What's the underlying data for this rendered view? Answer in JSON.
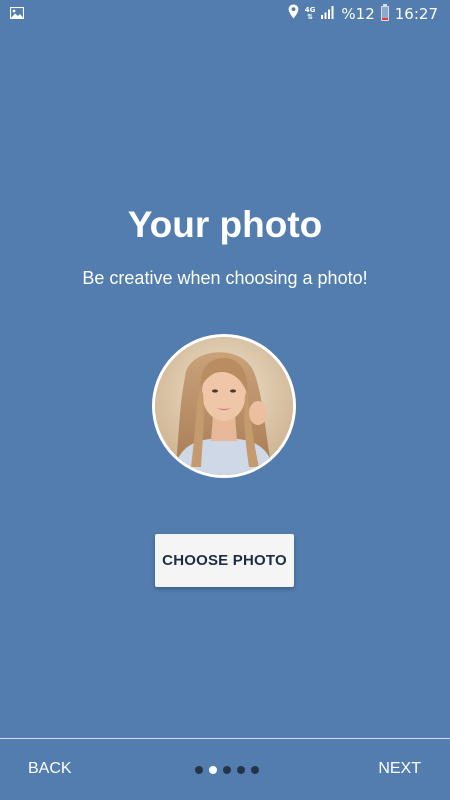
{
  "status_bar": {
    "network": "4G",
    "battery_text": "%12",
    "battery_level": 0.12,
    "time": "16:27",
    "icons": [
      "image-icon",
      "location-icon",
      "signal-icon",
      "battery-icon"
    ]
  },
  "main": {
    "title": "Your photo",
    "subtitle": "Be creative when choosing a photo!",
    "choose_photo_label": "CHOOSE PHOTO"
  },
  "footer": {
    "back_label": "BACK",
    "next_label": "NEXT",
    "page_count": 5,
    "active_page": 2
  },
  "colors": {
    "background": "#527dae",
    "button_bg": "#f5f5f5",
    "button_text": "#1f2d44",
    "dot_inactive": "#26344a",
    "dot_active": "#ffffff"
  }
}
